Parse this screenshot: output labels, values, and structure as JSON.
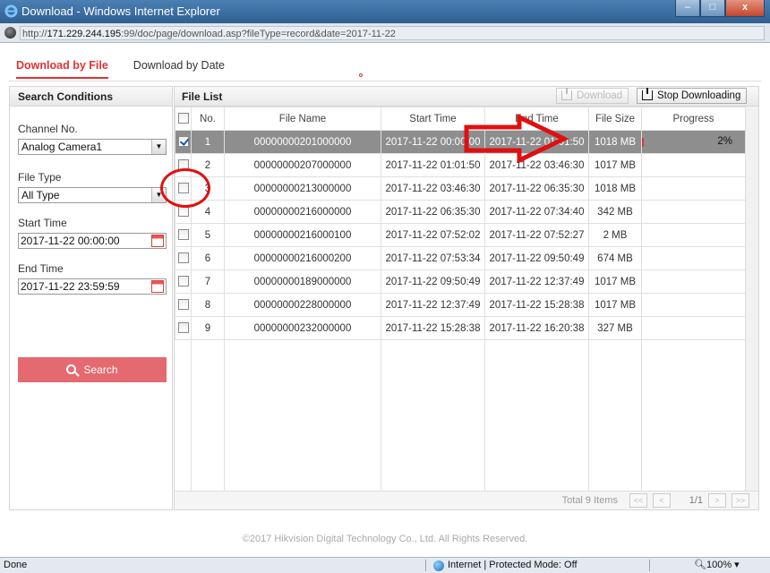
{
  "window": {
    "title": "Download - Windows Internet Explorer",
    "url_prefix": "http://",
    "url_host": "171.229.244.195",
    "url_rest": ":99/doc/page/download.asp?fileType=record&date=2017-11-22",
    "controls": {
      "minimize": "–",
      "maximize": "□",
      "close": "x"
    }
  },
  "tabs": [
    {
      "label": "Download by File",
      "active": true
    },
    {
      "label": "Download by Date",
      "active": false
    }
  ],
  "search": {
    "header": "Search Conditions",
    "channel_label": "Channel No.",
    "channel_value": "Analog Camera1",
    "file_type_label": "File Type",
    "file_type_value": "All Type",
    "start_label": "Start Time",
    "start_value": "2017-11-22 00:00:00",
    "end_label": "End Time",
    "end_value": "2017-11-22 23:59:59",
    "button_label": "Search"
  },
  "file_list": {
    "title": "File List",
    "download_label": "Download",
    "stop_label": "Stop Downloading",
    "columns": [
      "No.",
      "File Name",
      "Start Time",
      "End Time",
      "File Size",
      "Progress"
    ],
    "rows": [
      {
        "no": "1",
        "name": "00000000201000000",
        "start": "2017-11-22 00:00:00",
        "end": "2017-11-22 01:01:50",
        "size": "1018 MB",
        "progress": "2%",
        "progress_value": 0.02,
        "checked": true,
        "selected": true
      },
      {
        "no": "2",
        "name": "00000000207000000",
        "start": "2017-11-22 01:01:50",
        "end": "2017-11-22 03:46:30",
        "size": "1017 MB",
        "progress": "",
        "checked": false,
        "selected": false
      },
      {
        "no": "3",
        "name": "00000000213000000",
        "start": "2017-11-22 03:46:30",
        "end": "2017-11-22 06:35:30",
        "size": "1018 MB",
        "progress": "",
        "checked": false,
        "selected": false
      },
      {
        "no": "4",
        "name": "00000000216000000",
        "start": "2017-11-22 06:35:30",
        "end": "2017-11-22 07:34:40",
        "size": "342 MB",
        "progress": "",
        "checked": false,
        "selected": false
      },
      {
        "no": "5",
        "name": "00000000216000100",
        "start": "2017-11-22 07:52:02",
        "end": "2017-11-22 07:52:27",
        "size": "2 MB",
        "progress": "",
        "checked": false,
        "selected": false
      },
      {
        "no": "6",
        "name": "00000000216000200",
        "start": "2017-11-22 07:53:34",
        "end": "2017-11-22 09:50:49",
        "size": "674 MB",
        "progress": "",
        "checked": false,
        "selected": false
      },
      {
        "no": "7",
        "name": "00000000189000000",
        "start": "2017-11-22 09:50:49",
        "end": "2017-11-22 12:37:49",
        "size": "1017 MB",
        "progress": "",
        "checked": false,
        "selected": false
      },
      {
        "no": "8",
        "name": "00000000228000000",
        "start": "2017-11-22 12:37:49",
        "end": "2017-11-22 15:28:38",
        "size": "1017 MB",
        "progress": "",
        "checked": false,
        "selected": false
      },
      {
        "no": "9",
        "name": "00000000232000000",
        "start": "2017-11-22 15:28:38",
        "end": "2017-11-22 16:20:38",
        "size": "327 MB",
        "progress": "",
        "checked": false,
        "selected": false
      }
    ],
    "total": "Total 9 Items",
    "page": "1/1",
    "pager": {
      "first": "<<",
      "prev": "<",
      "next": ">",
      "last": ">>"
    }
  },
  "copyright": "©2017 Hikvision Digital Technology Co., Ltd. All Rights Reserved.",
  "status": {
    "left": "Done",
    "zone": "Internet | Protected Mode: Off",
    "zoom": "100%"
  },
  "colors": {
    "accent": "#e03333",
    "selected_row": "#8e8e8e",
    "search_button": "#e46a70",
    "annotation": "#e01010"
  }
}
